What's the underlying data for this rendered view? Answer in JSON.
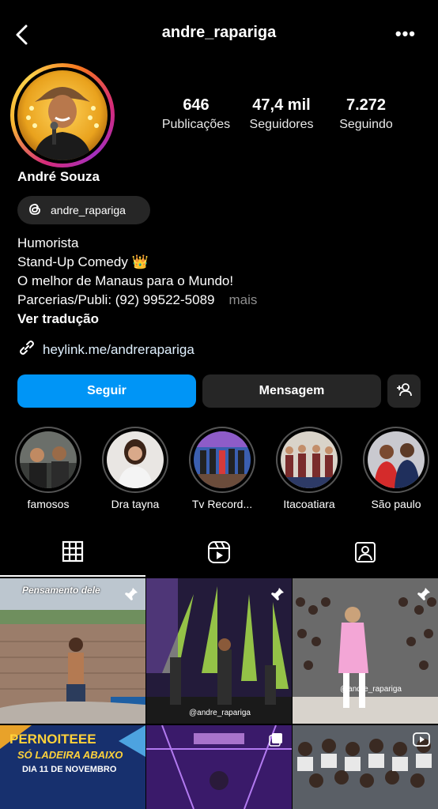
{
  "header": {
    "username": "andre_rapariga",
    "back_icon": "back-arrow-icon",
    "more_icon": "more-dots-icon",
    "more_glyph": "•••"
  },
  "profile": {
    "display_name": "André Souza",
    "threads_handle": "andre_rapariga",
    "stats": [
      {
        "value": "646",
        "label": "Publicações"
      },
      {
        "value": "47,4 mil",
        "label": "Seguidores"
      },
      {
        "value": "7.272",
        "label": "Seguindo"
      }
    ],
    "bio": [
      "Humorista",
      "Stand-Up Comedy 👑",
      "O melhor de Manaus para o Mundo!",
      "Parcerias/Publi: (92) 99522-5089"
    ],
    "more_label": "mais",
    "translate_label": "Ver tradução",
    "link": "heylink.me/andrerapariga"
  },
  "actions": {
    "follow_label": "Seguir",
    "message_label": "Mensagem",
    "add_icon": "add-person-icon"
  },
  "highlights": [
    {
      "label": "famosos"
    },
    {
      "label": "Dra tayna"
    },
    {
      "label": "Tv Record..."
    },
    {
      "label": "Itacoatiara"
    },
    {
      "label": "São paulo"
    }
  ],
  "tabs": [
    {
      "name": "grid",
      "icon": "grid-icon"
    },
    {
      "name": "reels",
      "icon": "reels-icon"
    },
    {
      "name": "tagged",
      "icon": "tagged-icon"
    }
  ],
  "posts": [
    {
      "caption": "Pensamento dele",
      "pinned": true
    },
    {
      "caption": "@andre_rapariga",
      "pinned": true
    },
    {
      "caption": "@andre_rapariga",
      "pinned": true
    },
    {
      "caption_lines": [
        "PERNOITEEE",
        "SÓ LADEIRA ABAIXO",
        "DIA 11 DE NOVEMBRO"
      ]
    },
    {
      "caption": ""
    },
    {
      "caption": ""
    }
  ],
  "colors": {
    "background": "#000000",
    "follow_button": "#0095f6",
    "secondary_button": "#262626",
    "muted_text": "#8e8e8e"
  }
}
